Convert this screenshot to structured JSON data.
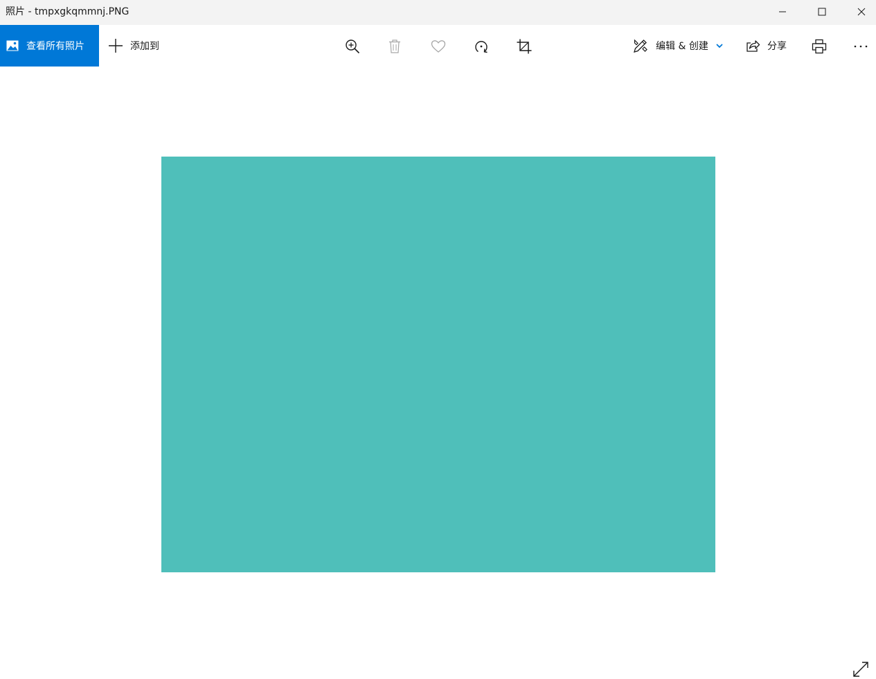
{
  "window": {
    "title": "照片 - tmpxgkqmmnj.PNG",
    "controls": {
      "minimize_icon": "minimize-icon",
      "maximize_icon": "maximize-icon",
      "close_icon": "close-icon"
    }
  },
  "toolbar": {
    "view_all_label": "查看所有照片",
    "add_to_label": "添加到",
    "tools": [
      {
        "name": "zoom-in-icon",
        "enabled": true
      },
      {
        "name": "delete-icon",
        "enabled": false
      },
      {
        "name": "favorite-icon",
        "enabled": false
      },
      {
        "name": "rotate-icon",
        "enabled": true
      },
      {
        "name": "crop-icon",
        "enabled": true
      }
    ],
    "edit_create_label": "编辑 & 创建",
    "share_label": "分享",
    "print_icon": "print-icon",
    "more_icon": "more-icon"
  },
  "viewer": {
    "photo_color": "#4fbfba"
  },
  "colors": {
    "accent": "#0078d7",
    "titlebar_bg": "#f3f3f3",
    "disabled_icon": "#a6a6a6"
  }
}
